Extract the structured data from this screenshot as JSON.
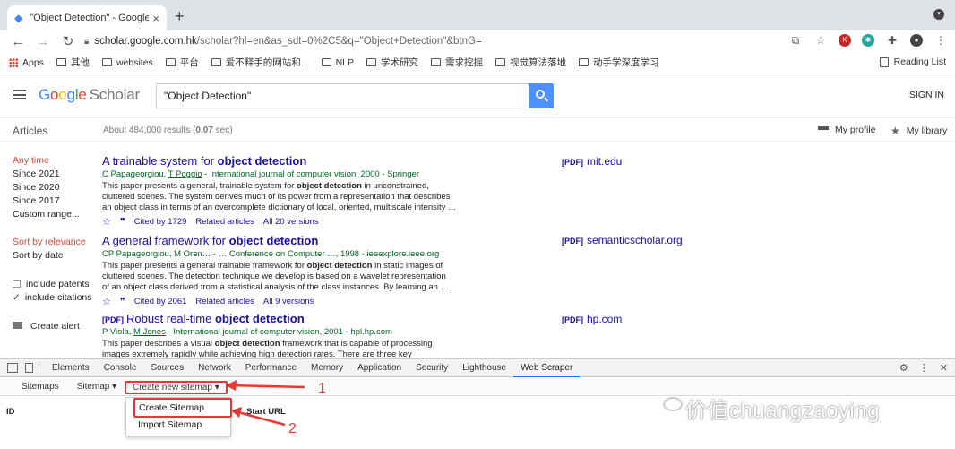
{
  "browser": {
    "tab_title": "\"Object Detection\" - Google Sc",
    "new_tab": "+",
    "url_host": "scholar.google.com.hk",
    "url_rest": "/scholar?hl=en&as_sdt=0%2C5&q=\"Object+Detection\"&btnG="
  },
  "bookmarks": {
    "items": [
      "Apps",
      "其他",
      "websites",
      "平台",
      "爱不释手的网站和...",
      "NLP",
      "学术研究",
      "需求挖掘",
      "视觉算法落地",
      "动手学深度学习"
    ],
    "reading_list": "Reading List"
  },
  "scholar": {
    "logo_google": [
      "G",
      "o",
      "o",
      "g",
      "l",
      "e"
    ],
    "logo_scholar": "Scholar",
    "search_value": "\"Object Detection\"",
    "sign_in": "SIGN IN",
    "articles_label": "Articles",
    "about_prefix": "About 484,000 results (",
    "about_time": "0.07",
    "about_suffix": " sec)",
    "my_profile": "My profile",
    "my_library": "My library"
  },
  "filters": {
    "time": [
      "Any time",
      "Since 2021",
      "Since 2020",
      "Since 2017",
      "Custom range..."
    ],
    "sort": [
      "Sort by relevance",
      "Sort by date"
    ],
    "include_patents": "include patents",
    "include_citations": "include citations",
    "create_alert": "Create alert"
  },
  "results": [
    {
      "title_pre": "A trainable system for ",
      "title_bold": "object detection",
      "authors_pre": "C Papageorgiou, ",
      "authors_link": "T Poggio",
      "authors_post": " - International journal of computer vision, 2000 - Springer",
      "snippet_1a": "This paper presents a general, trainable system for ",
      "snippet_1b": "object detection",
      "snippet_1c": " in unconstrained,",
      "snippet_2": "cluttered scenes. The system derives much of its power from a representation that describes",
      "snippet_3": "an object class in terms of an overcomplete dictionary of local, oriented, multiscale intensity …",
      "cited": "Cited by 1729",
      "related": "Related articles",
      "versions": "All 20 versions",
      "side_tag": "[PDF]",
      "side_host": "mit.edu"
    },
    {
      "title_pre": "A general framework for ",
      "title_bold": "object detection",
      "authors_pre": "CP Papageorgiou, M Oren… - … Conference on Computer …, 1998 - ieeexplore.ieee.org",
      "snippet_1a": "This paper presents a general trainable framework for ",
      "snippet_1b": "object detection",
      "snippet_1c": " in static images of",
      "snippet_2": "cluttered scenes. The detection technique we develop is based on a wavelet representation",
      "snippet_3": "of an object class derived from a statistical analysis of the class instances. By learning an …",
      "cited": "Cited by 2061",
      "related": "Related articles",
      "versions": "All 9 versions",
      "side_tag": "[PDF]",
      "side_host": "semanticscholar.org"
    },
    {
      "title_tag": "[PDF]",
      "title_pre": "Robust real-time ",
      "title_bold": "object detection",
      "authors_pre": "P Viola, ",
      "authors_link": "M Jones",
      "authors_post": " - International journal of computer vision, 2001 - hpl.hp.com",
      "snippet_1a": "This paper describes a visual ",
      "snippet_1b": "object detection",
      "snippet_1c": " framework that is capable of processing",
      "snippet_2": "images extremely rapidly while achieving high detection rates. There are three key",
      "side_tag": "[PDF]",
      "side_host": "hp.com"
    }
  ],
  "devtools": {
    "tabs": [
      "Elements",
      "Console",
      "Sources",
      "Network",
      "Performance",
      "Memory",
      "Application",
      "Security",
      "Lighthouse",
      "Web Scraper"
    ],
    "active_tab": "Web Scraper",
    "sitemaps": "Sitemaps",
    "sitemap": "Sitemap ▾",
    "create_new_sitemap": "Create new sitemap ▾",
    "col_id": "ID",
    "col_start_url": "Start URL",
    "create_sitemap": "Create Sitemap",
    "import_sitemap": "Import Sitemap"
  },
  "annotations": {
    "label_1": "1",
    "label_2": "2",
    "color": "#e53935",
    "watermark": "价值chuangzaoying"
  }
}
